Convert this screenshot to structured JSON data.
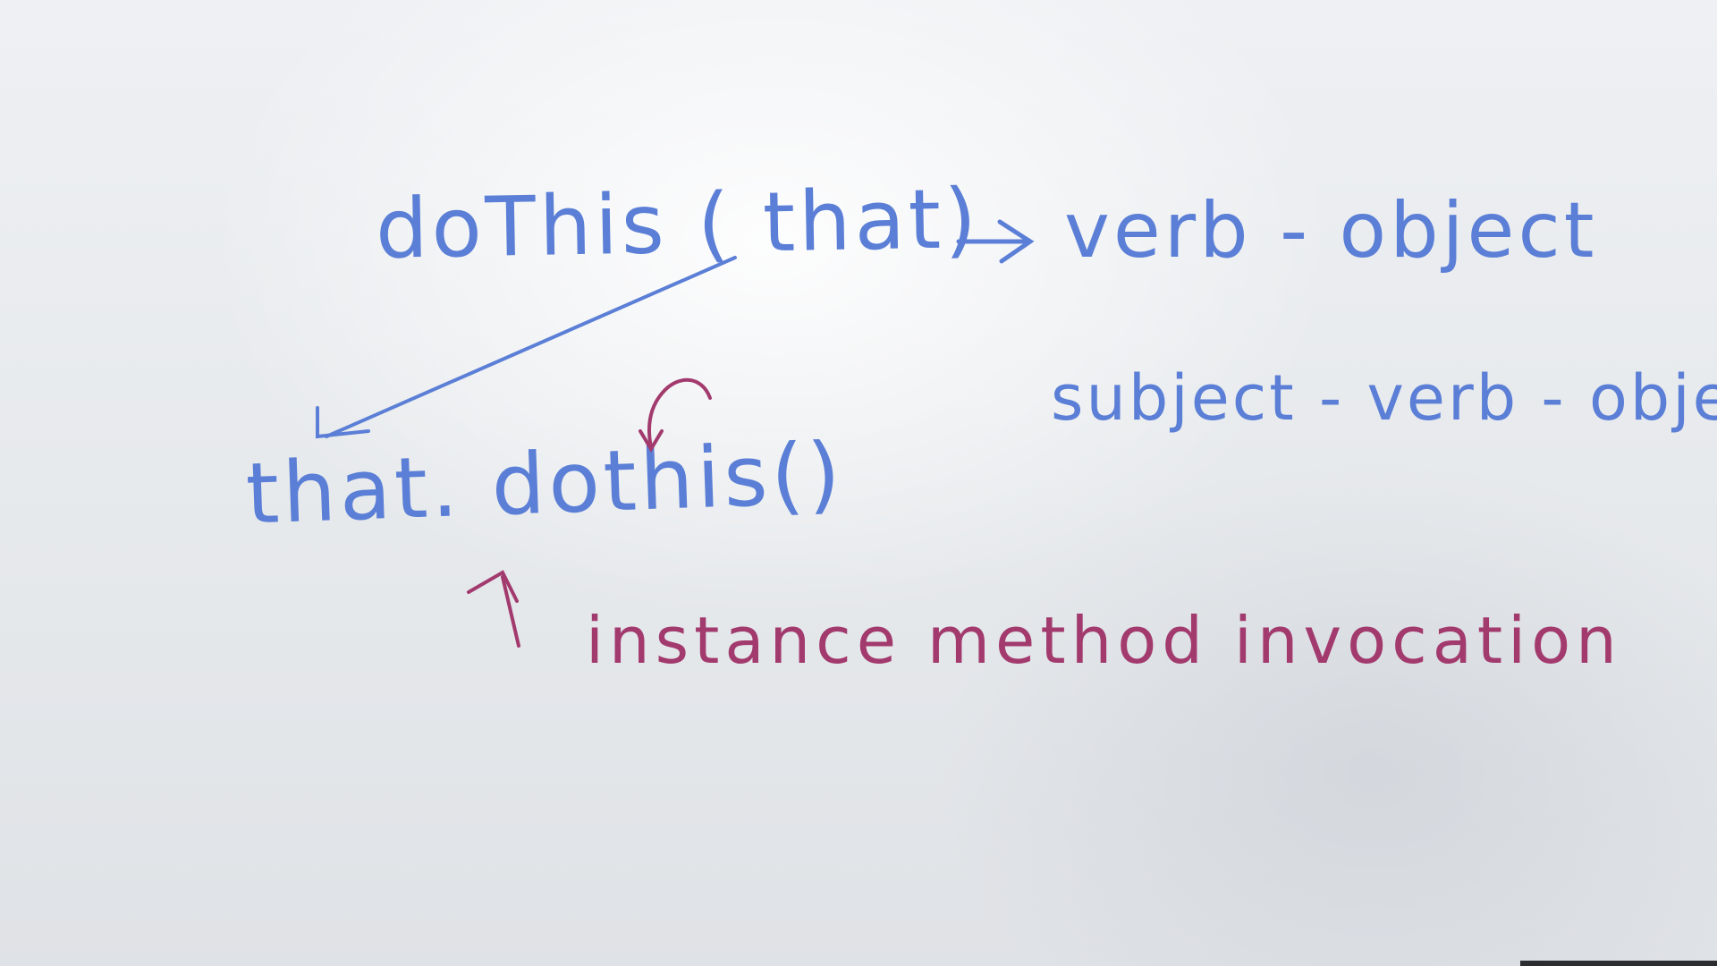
{
  "whiteboard": {
    "line_dothis": "doThis ( that)",
    "line_verb_object": "verb - object",
    "line_svo": "subject - verb - object",
    "line_that_dothis": "that. dothis()",
    "line_instance": "instance method invocation"
  },
  "colors": {
    "board": "#e9ecef",
    "blue_marker": "#5b7fd6",
    "purple_marker": "#a23a6e"
  }
}
